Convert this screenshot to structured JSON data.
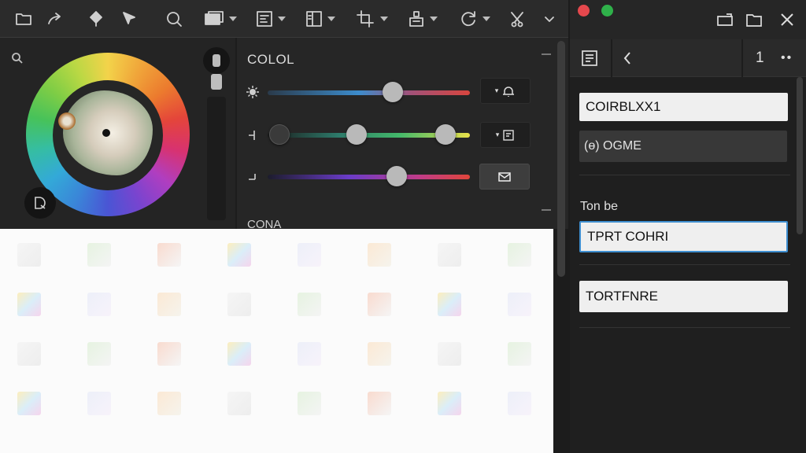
{
  "toolbar": {
    "icons": [
      "folder-icon",
      "share-icon",
      "bucket-icon",
      "cursor-icon",
      "magnify-icon",
      "layers-icon",
      "frame-icon",
      "panel-icon",
      "crop-icon",
      "export-icon",
      "rotate-icon",
      "cut-icon"
    ]
  },
  "color_panel": {
    "title": "COLOL",
    "section2_title": "CONA",
    "sliders": [
      {
        "name": "hue",
        "values": [
          0.62
        ]
      },
      {
        "name": "saturation",
        "values": [
          0.06,
          0.44,
          0.88
        ]
      },
      {
        "name": "lightness",
        "values": [
          0.64
        ]
      }
    ],
    "colors": {
      "accent": "#3e8ed0",
      "wheel_center": "#c8c2b4"
    }
  },
  "right_panel": {
    "header_number": "1",
    "field1_value": "COIRBLXX1",
    "option_label": "(ɵ) OGME",
    "section_label": "Ton be",
    "field2_value": "TPRT COHRI",
    "field3_value": "TORTFNRE"
  },
  "window_controls": {
    "close_color": "#e5484d",
    "maximize_color": "#2fb14a"
  }
}
